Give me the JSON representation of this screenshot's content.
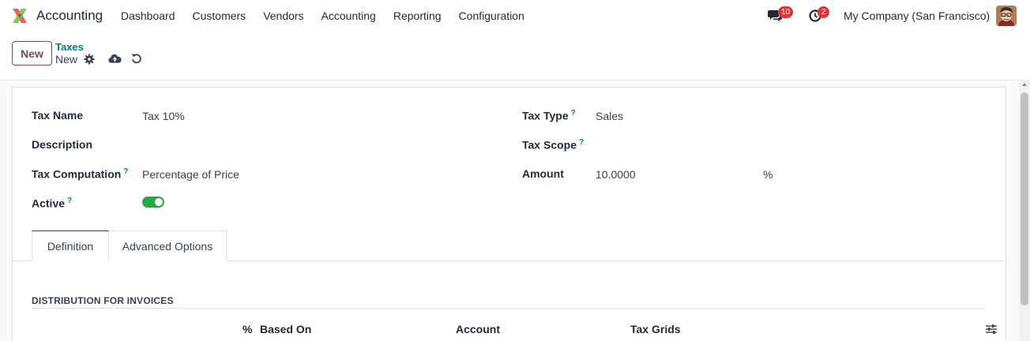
{
  "navbar": {
    "app_name": "Accounting",
    "menu": [
      "Dashboard",
      "Customers",
      "Vendors",
      "Accounting",
      "Reporting",
      "Configuration"
    ],
    "chat_count": "10",
    "activity_count": "2",
    "company": "My Company (San Francisco)"
  },
  "control_panel": {
    "new_label": "New",
    "breadcrumb_parent": "Taxes",
    "breadcrumb_current": "New"
  },
  "form": {
    "tax_name_label": "Tax Name",
    "tax_name_value": "Tax 10%",
    "description_label": "Description",
    "tax_computation_label": "Tax Computation",
    "tax_computation_value": "Percentage of Price",
    "active_label": "Active",
    "active_value": true,
    "tax_type_label": "Tax Type",
    "tax_type_value": "Sales",
    "tax_scope_label": "Tax Scope",
    "amount_label": "Amount",
    "amount_value": "10.0000",
    "amount_unit": "%",
    "help_mark": "?"
  },
  "tabs": [
    "Definition",
    "Advanced Options"
  ],
  "distribution": {
    "title": "DISTRIBUTION FOR INVOICES",
    "columns": [
      "%",
      "Based On",
      "Account",
      "Tax Grids"
    ]
  },
  "colors": {
    "brand": "#714b67",
    "link": "#017e84",
    "toggle_on": "#28a745",
    "badge": "#d9363e"
  }
}
